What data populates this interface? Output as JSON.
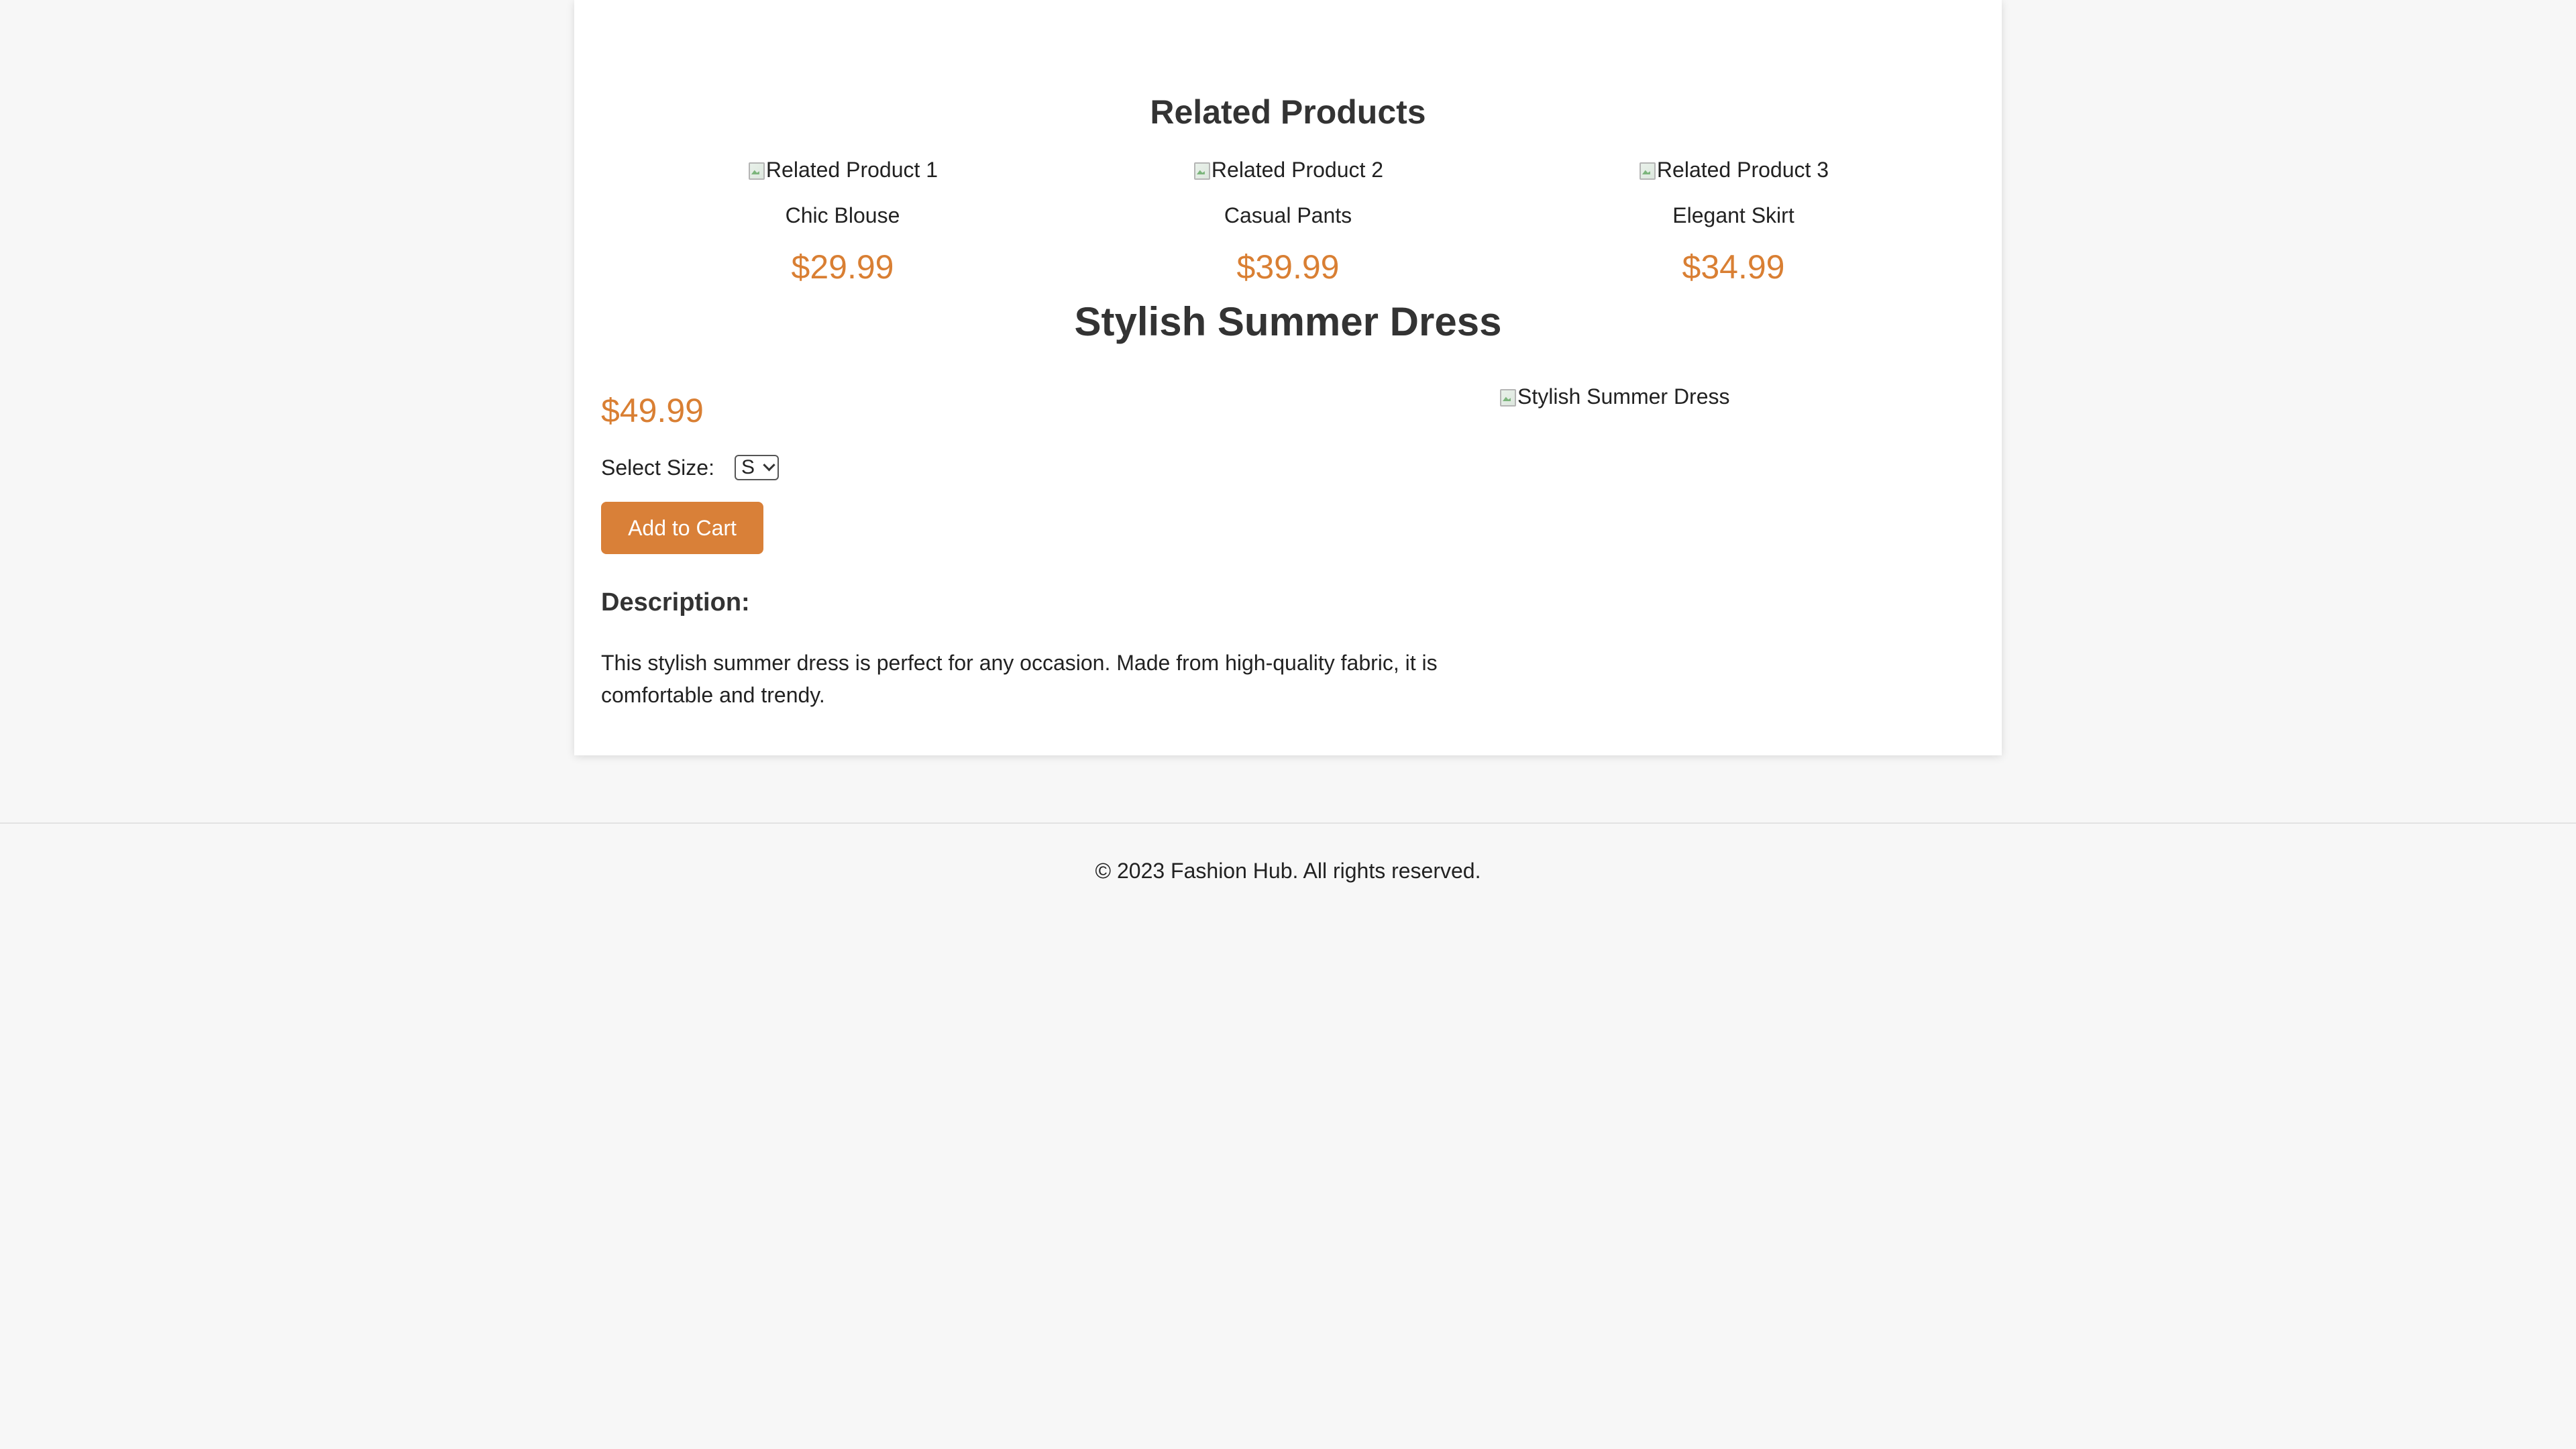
{
  "related": {
    "heading": "Related Products",
    "items": [
      {
        "alt": "Related Product 1",
        "name": "Chic Blouse",
        "price": "$29.99"
      },
      {
        "alt": "Related Product 2",
        "name": "Casual Pants",
        "price": "$39.99"
      },
      {
        "alt": "Related Product 3",
        "name": "Elegant Skirt",
        "price": "$34.99"
      }
    ]
  },
  "product": {
    "title": "Stylish Summer Dress",
    "price": "$49.99",
    "size_label": "Select Size:",
    "size_selected": "S",
    "add_to_cart_label": "Add to Cart",
    "description_heading": "Description:",
    "description_text": "This stylish summer dress is perfect for any occasion. Made from high-quality fabric, it is comfortable and trendy.",
    "image_alt": "Stylish Summer Dress"
  },
  "footer": {
    "copyright": "© 2023 Fashion Hub. All rights reserved."
  },
  "colors": {
    "accent": "#d98038",
    "page_bg": "#f7f7f7",
    "card_bg": "#ffffff"
  },
  "icons": {
    "broken_image": "broken-image-icon",
    "dropdown": "chevron-down-icon"
  }
}
